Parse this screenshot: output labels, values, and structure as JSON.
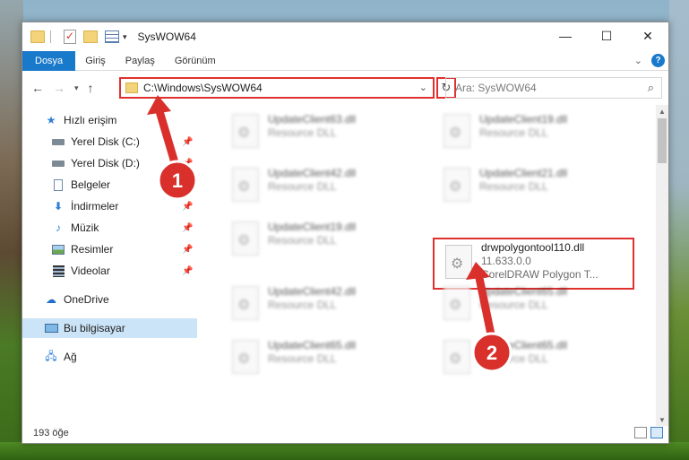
{
  "window": {
    "title": "SysWOW64",
    "controls": {
      "minimize": "—",
      "maximize": "☐",
      "close": "✕"
    }
  },
  "ribbon": {
    "tabs": [
      "Dosya",
      "Giriş",
      "Paylaş",
      "Görünüm"
    ],
    "help": "?"
  },
  "nav": {
    "address": "C:\\Windows\\SysWOW64",
    "search_placeholder": "Ara: SysWOW64"
  },
  "sidebar": {
    "items": [
      {
        "label": "Hızlı erişim",
        "icon": "star-icon"
      },
      {
        "label": "Yerel Disk (C:)",
        "icon": "drive-icon",
        "pinned": true
      },
      {
        "label": "Yerel Disk (D:)",
        "icon": "drive-icon",
        "pinned": true
      },
      {
        "label": "Belgeler",
        "icon": "document-icon",
        "pinned": true
      },
      {
        "label": "İndirmeler",
        "icon": "download-icon",
        "pinned": true
      },
      {
        "label": "Müzik",
        "icon": "music-icon",
        "pinned": true
      },
      {
        "label": "Resimler",
        "icon": "pictures-icon",
        "pinned": true
      },
      {
        "label": "Videolar",
        "icon": "video-icon",
        "pinned": true
      },
      {
        "label": "OneDrive",
        "icon": "cloud-icon"
      },
      {
        "label": "Bu bilgisayar",
        "icon": "computer-icon",
        "selected": true
      },
      {
        "label": "Ağ",
        "icon": "network-icon"
      }
    ]
  },
  "files": [
    {
      "name": "UpdateClient63.dll",
      "sub": "Resource DLL",
      "blurred": true
    },
    {
      "name": "UpdateClient19.dll",
      "sub": "Resource DLL",
      "blurred": true
    },
    {
      "name": "UpdateClient42.dll",
      "sub": "Resource DLL",
      "blurred": true
    },
    {
      "name": "UpdateClient21.dll",
      "sub": "Resource DLL",
      "blurred": true
    },
    {
      "name": "UpdateClient19.dll",
      "sub": "Resource DLL",
      "blurred": true
    },
    {
      "name": "drwpolygontool110.dll",
      "sub": "11.633.0.0",
      "sub2": "CorelDRAW Polygon T...",
      "blurred": false,
      "highlighted": true
    },
    {
      "name": "UpdateClient42.dll",
      "sub": "Resource DLL",
      "blurred": true
    },
    {
      "name": "UpdateClient65.dll",
      "sub": "Resource DLL",
      "blurred": true
    },
    {
      "name": "UpdateClient65.dll",
      "sub": "Resource DLL",
      "blurred": true
    },
    {
      "name": "UpdateClient65.dll",
      "sub": "Resource DLL",
      "blurred": true
    }
  ],
  "status": {
    "count": "193 öğe"
  },
  "annotations": {
    "step1": "1",
    "step2": "2",
    "color": "#d9302c"
  }
}
